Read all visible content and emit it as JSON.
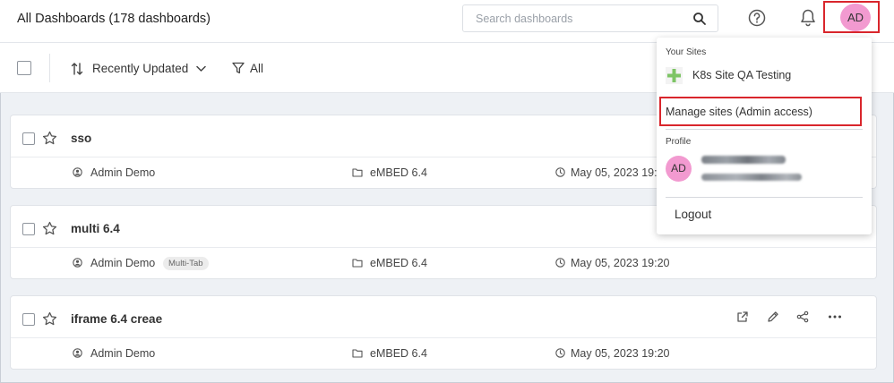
{
  "header": {
    "title": "All Dashboards (178 dashboards)",
    "search_placeholder": "Search dashboards",
    "avatar_initials": "AD"
  },
  "toolbar": {
    "sort_label": "Recently Updated",
    "filter_label": "All"
  },
  "dashboards": [
    {
      "name": "sso",
      "owner": "Admin Demo",
      "badge": "",
      "folder": "eMBED 6.4",
      "updated": "May 05, 2023 19:20"
    },
    {
      "name": "multi 6.4",
      "owner": "Admin Demo",
      "badge": "Multi-Tab",
      "folder": "eMBED 6.4",
      "updated": "May 05, 2023 19:20"
    },
    {
      "name": "iframe 6.4 creae",
      "owner": "Admin Demo",
      "badge": "",
      "folder": "eMBED 6.4",
      "updated": "May 05, 2023 19:20"
    }
  ],
  "menu": {
    "your_sites_label": "Your Sites",
    "site_name": "K8s Site QA Testing",
    "manage_sites_label": "Manage sites (Admin access)",
    "profile_label": "Profile",
    "profile_initials": "AD",
    "logout_label": "Logout"
  },
  "colors": {
    "avatar_bg": "#f29ad0",
    "highlight_border": "#d9262c",
    "site_icon": "#7dc465"
  }
}
